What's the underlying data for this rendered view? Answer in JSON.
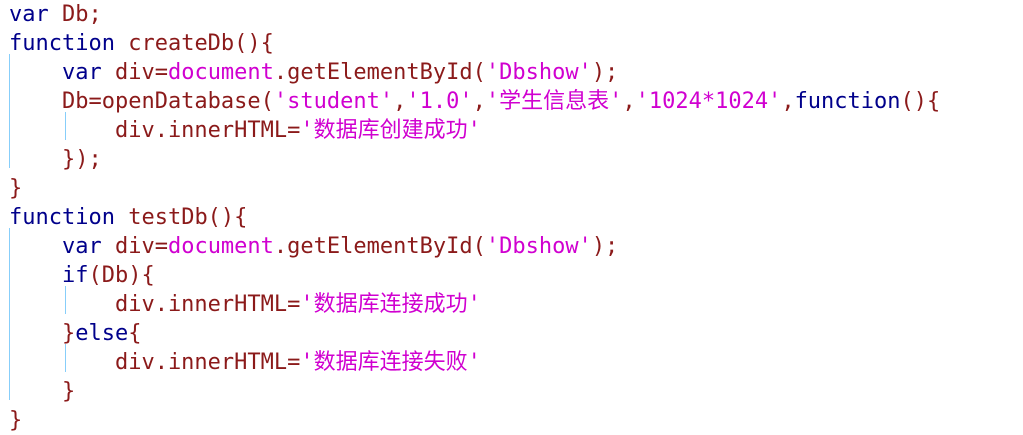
{
  "editor": {
    "colors": {
      "background": "#ffffff",
      "keyword": "#00008b",
      "plain": "#8b1a1a",
      "string": "#d000d0",
      "indent_guide": "#87cefa"
    },
    "lines": [
      [
        {
          "t": "var",
          "c": "kw"
        },
        {
          "t": " Db;",
          "c": "plain"
        }
      ],
      [
        {
          "t": "function",
          "c": "kw"
        },
        {
          "t": " createDb(){",
          "c": "plain"
        }
      ],
      [
        {
          "t": "    var",
          "c": "kw"
        },
        {
          "t": " div=",
          "c": "plain"
        },
        {
          "t": "document",
          "c": "obj"
        },
        {
          "t": ".getElementById(",
          "c": "plain"
        },
        {
          "t": "'Dbshow'",
          "c": "str"
        },
        {
          "t": ");",
          "c": "plain"
        }
      ],
      [
        {
          "t": "    Db=openDatabase(",
          "c": "plain"
        },
        {
          "t": "'student'",
          "c": "str"
        },
        {
          "t": ",",
          "c": "plain"
        },
        {
          "t": "'1.0'",
          "c": "str"
        },
        {
          "t": ",",
          "c": "plain"
        },
        {
          "t": "'学生信息表'",
          "c": "str"
        },
        {
          "t": ",",
          "c": "plain"
        },
        {
          "t": "'1024*1024'",
          "c": "str"
        },
        {
          "t": ",",
          "c": "plain"
        },
        {
          "t": "function",
          "c": "kw"
        },
        {
          "t": "(){",
          "c": "plain"
        }
      ],
      [
        {
          "t": "        div.innerHTML=",
          "c": "plain"
        },
        {
          "t": "'数据库创建成功'",
          "c": "str"
        }
      ],
      [
        {
          "t": "    });",
          "c": "plain"
        }
      ],
      [
        {
          "t": "}",
          "c": "plain"
        }
      ],
      [
        {
          "t": "function",
          "c": "kw"
        },
        {
          "t": " testDb(){",
          "c": "plain"
        }
      ],
      [
        {
          "t": "    var",
          "c": "kw"
        },
        {
          "t": " div=",
          "c": "plain"
        },
        {
          "t": "document",
          "c": "obj"
        },
        {
          "t": ".getElementById(",
          "c": "plain"
        },
        {
          "t": "'Dbshow'",
          "c": "str"
        },
        {
          "t": ");",
          "c": "plain"
        }
      ],
      [
        {
          "t": "    if",
          "c": "kw"
        },
        {
          "t": "(Db){",
          "c": "plain"
        }
      ],
      [
        {
          "t": "        div.innerHTML=",
          "c": "plain"
        },
        {
          "t": "'数据库连接成功'",
          "c": "str"
        }
      ],
      [
        {
          "t": "    }",
          "c": "plain"
        },
        {
          "t": "else",
          "c": "kw"
        },
        {
          "t": "{",
          "c": "plain"
        }
      ],
      [
        {
          "t": "        div.innerHTML=",
          "c": "plain"
        },
        {
          "t": "'数据库连接失败'",
          "c": "str"
        }
      ],
      [
        {
          "t": "    }",
          "c": "plain"
        }
      ],
      [
        {
          "t": "}",
          "c": "plain"
        }
      ]
    ]
  }
}
